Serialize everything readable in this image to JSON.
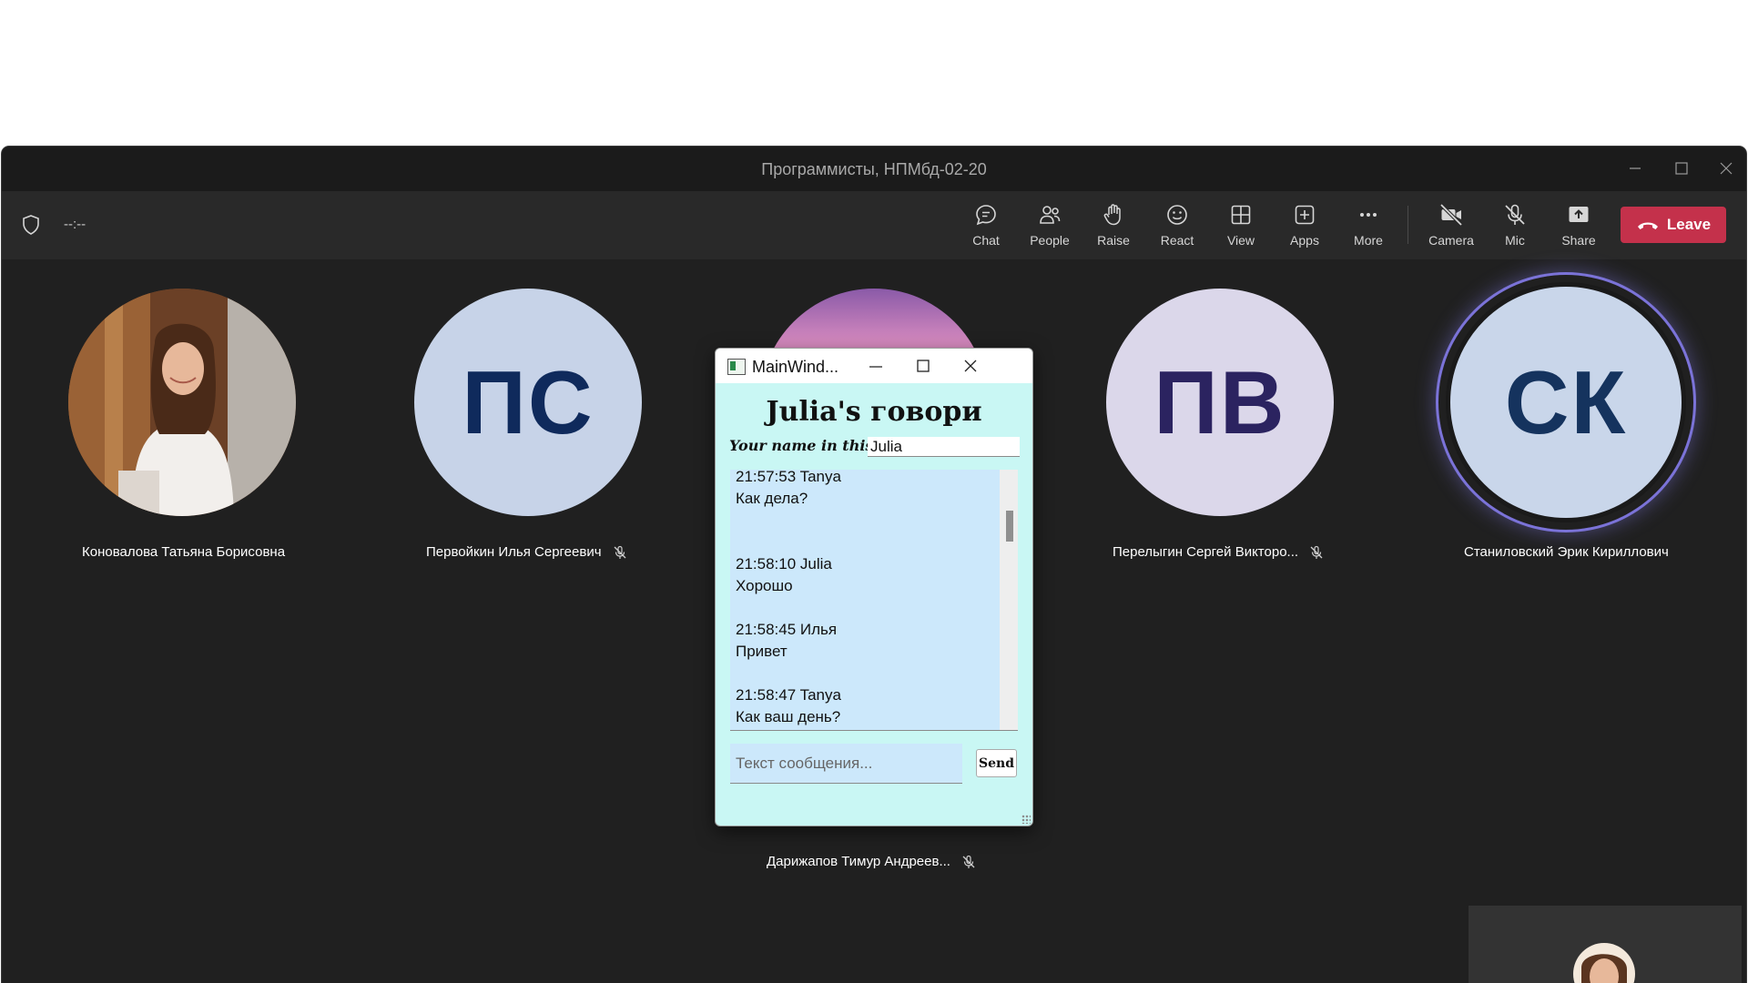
{
  "window": {
    "title": "Программисты, НПМбд-02-20"
  },
  "toolbar": {
    "timer": "--:--",
    "buttons": [
      {
        "id": "chat",
        "label": "Chat",
        "icon": "chat-icon"
      },
      {
        "id": "people",
        "label": "People",
        "icon": "people-icon"
      },
      {
        "id": "raise",
        "label": "Raise",
        "icon": "hand-icon"
      },
      {
        "id": "react",
        "label": "React",
        "icon": "smile-icon"
      },
      {
        "id": "view",
        "label": "View",
        "icon": "grid-icon"
      },
      {
        "id": "apps",
        "label": "Apps",
        "icon": "plus-box-icon"
      },
      {
        "id": "more",
        "label": "More",
        "icon": "ellipsis-icon"
      },
      {
        "id": "camera",
        "label": "Camera",
        "icon": "camera-off-icon"
      },
      {
        "id": "mic",
        "label": "Mic",
        "icon": "mic-off-icon"
      },
      {
        "id": "share",
        "label": "Share",
        "icon": "share-icon"
      }
    ],
    "leave_label": "Leave",
    "leave_color": "#c4314b"
  },
  "participants": [
    {
      "name": "Коновалова Татьяна Борисовна",
      "avatar": "photo",
      "muted": false
    },
    {
      "name": "Первойкин Илья Сергеевич",
      "initials": "ПС",
      "muted": true
    },
    {
      "name": "Перелыгин Сергей Викторо...",
      "initials": "ПВ",
      "muted": true
    },
    {
      "name": "Станиловский Эрик Кириллович",
      "initials": "СК",
      "muted": false,
      "speaking": true
    },
    {
      "name": "Дарижапов Тимур Андреев...",
      "avatar": "photo",
      "muted": true
    }
  ],
  "chat_app": {
    "window_title": "MainWind...",
    "heading": "Julia's говори",
    "name_label": "Your name in this u",
    "name_value": "Julia",
    "messages": [
      {
        "time_user": "21:57:53 Tanya",
        "text": "Как дела?"
      },
      {
        "time_user": "21:58:10 Julia",
        "text": "Хорошо"
      },
      {
        "time_user": "21:58:45 Илья",
        "text": "Привет"
      },
      {
        "time_user": "21:58:47 Tanya",
        "text": "Как ваш день?"
      }
    ],
    "input_placeholder": "Текст сообщения...",
    "send_label": "Send",
    "background_color": "#c9f7f4",
    "chat_bg_color": "#cce8fb"
  }
}
